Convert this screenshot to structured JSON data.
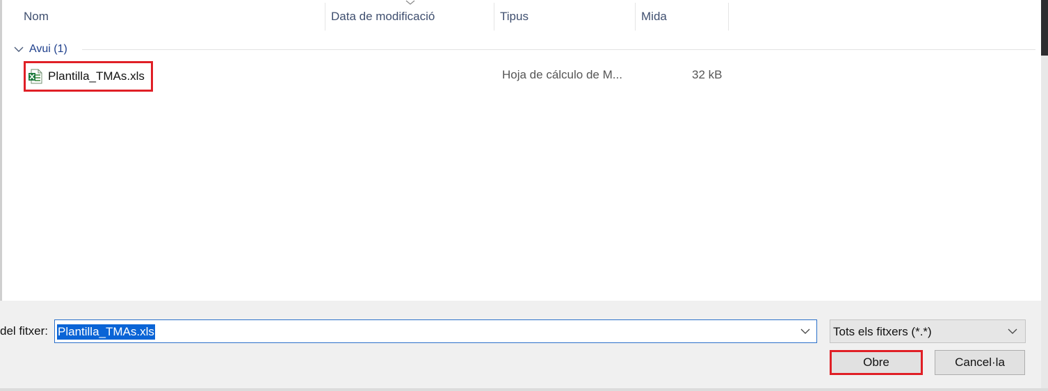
{
  "columns": {
    "name": "Nom",
    "modified": "Data de modificació",
    "type": "Tipus",
    "size": "Mida"
  },
  "group": {
    "label": "Avui (1)"
  },
  "files": [
    {
      "name": "Plantilla_TMAs.xls",
      "type": "Hoja de cálculo de M...",
      "size": "32 kB",
      "icon": "excel-file-icon"
    }
  ],
  "footer": {
    "filename_label": "del fitxer:",
    "filename_value": "Plantilla_TMAs.xls",
    "filter_value": "Tots els fitxers (*.*)",
    "open_label": "Obre",
    "cancel_label": "Cancel·la"
  },
  "colors": {
    "highlight_border": "#e01f26",
    "selection_bg": "#0a64d6",
    "group_text": "#1e3f8c"
  }
}
